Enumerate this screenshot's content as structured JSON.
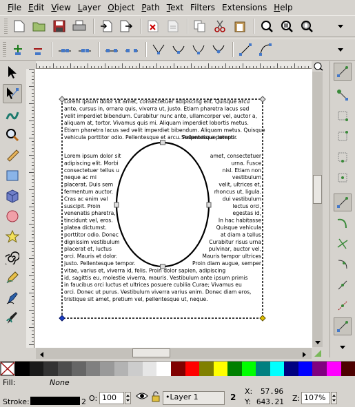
{
  "menu": [
    {
      "u": "F",
      "rest": "ile"
    },
    {
      "u": "E",
      "rest": "dit"
    },
    {
      "u": "V",
      "rest": "iew"
    },
    {
      "u": "L",
      "rest": "ayer"
    },
    {
      "u": "O",
      "rest": "bject"
    },
    {
      "u": "P",
      "rest": "ath"
    },
    {
      "u": "T",
      "rest": "ext"
    },
    {
      "u": "",
      "rest": "Filters"
    },
    {
      "u": "",
      "rest": "Extensions"
    },
    {
      "u": "H",
      "rest": "elp"
    }
  ],
  "canvas": {
    "text_top": "Lorem ipsum dolor sit amet, consectetuer adipiscing elit. Quisque arcu ante, cursus in, ornare quis, viverra ut, justo. Etiam pharetra lacus sed velit imperdiet bibendum. Curabitur nunc ante, ullamcorper vel, auctor a, aliquam at, tortor. Vivamus quis mi. Aliquam imperdiet lobortis metus. Etiam pharetra lacus sed velit imperdiet bibendum. Aliquam metus. Quisque vehicula porttitor odio. Pellentesque et arcu. Pellentesque tempor.",
    "text_top_tail": "Suspendisse potenti.",
    "left_lines": [
      "Lorem ipsum dolor sit",
      "adipiscing elit. Morbi",
      "consectetuer tellus u",
      "neque ac mi",
      "placerat. Duis sem",
      "fermentum auctor.",
      "Cras ac enim vel",
      "suscipit. Proin",
      "venenatis pharetra,",
      "tincidunt vel, eros.",
      "platea dictumst.",
      "porttitor odio. Donec",
      "dignissim vestibulum",
      "placerat et, luctus",
      "orci. Mauris et dolor.",
      "justo. Pellentesque tempor."
    ],
    "right_lines": [
      "amet, consectetuer",
      "urna. Fusce",
      "nisl. Etiam non",
      "vestibulum",
      "velit, ultrices et,",
      "rhoncus ut, ligula.",
      "dui vestibulum",
      "lectus orci,",
      "egestas id,",
      "In hac habitasse",
      "Quisque vehicula",
      "at diam a tellus",
      "Curabitur risus urna",
      "pulvinar, auctor vel,",
      "Mauris tempor ultrices",
      "Proin diam augue, semper"
    ],
    "text_bottom": [
      "vitae, varius et, viverra id, felis.        Proin dolor sapien, adipiscing",
      "id, sagittis eu, molestie viverra, mauris. Vestibulum ante ipsum primis",
      "in faucibus orci luctus et ultrices posuere cubilia Curae; Vivamus eu",
      "orci. Donec ut purus. Vestibulum viverra varius enim. Donec diam eros,",
      "tristique sit amet, pretium vel, pellentesque ut, neque."
    ]
  },
  "status": {
    "fill_label": "Fill:",
    "fill_value": "None",
    "stroke_label": "Stroke:",
    "stroke_width": "2",
    "opacity_label": "O:",
    "opacity_value": "100",
    "layer_name": "Layer 1",
    "x_label": "X:",
    "x_value": "57.96",
    "y_label": "Y:",
    "y_value": "643.21",
    "zoom_label": "Z:",
    "zoom_value": "107%",
    "flag_count": "2"
  },
  "palette": [
    "#ffffff",
    "#000000",
    "#1a1a1a",
    "#333333",
    "#4d4d4d",
    "#666666",
    "#808080",
    "#999999",
    "#b3b3b3",
    "#cccccc",
    "#e6e6e6",
    "#ffffff",
    "#800000",
    "#ff0000",
    "#808000",
    "#ffff00",
    "#008000",
    "#00ff00",
    "#008080",
    "#00ffff",
    "#000080",
    "#0000ff",
    "#800080",
    "#ff00ff",
    "#4d0000"
  ]
}
